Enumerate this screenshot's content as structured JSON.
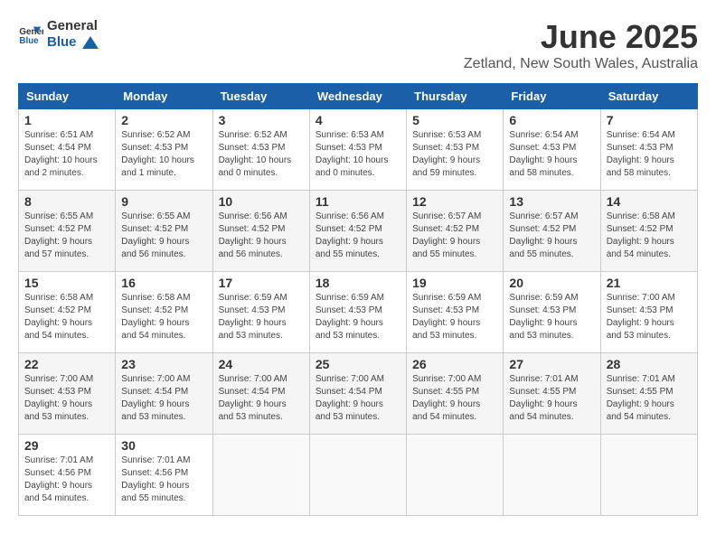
{
  "logo": {
    "line1": "General",
    "line2": "Blue"
  },
  "title": "June 2025",
  "subtitle": "Zetland, New South Wales, Australia",
  "headers": [
    "Sunday",
    "Monday",
    "Tuesday",
    "Wednesday",
    "Thursday",
    "Friday",
    "Saturday"
  ],
  "weeks": [
    [
      {
        "day": "1",
        "sunrise": "6:51 AM",
        "sunset": "4:54 PM",
        "daylight": "10 hours and 2 minutes."
      },
      {
        "day": "2",
        "sunrise": "6:52 AM",
        "sunset": "4:53 PM",
        "daylight": "10 hours and 1 minute."
      },
      {
        "day": "3",
        "sunrise": "6:52 AM",
        "sunset": "4:53 PM",
        "daylight": "10 hours and 0 minutes."
      },
      {
        "day": "4",
        "sunrise": "6:53 AM",
        "sunset": "4:53 PM",
        "daylight": "10 hours and 0 minutes."
      },
      {
        "day": "5",
        "sunrise": "6:53 AM",
        "sunset": "4:53 PM",
        "daylight": "9 hours and 59 minutes."
      },
      {
        "day": "6",
        "sunrise": "6:54 AM",
        "sunset": "4:53 PM",
        "daylight": "9 hours and 58 minutes."
      },
      {
        "day": "7",
        "sunrise": "6:54 AM",
        "sunset": "4:53 PM",
        "daylight": "9 hours and 58 minutes."
      }
    ],
    [
      {
        "day": "8",
        "sunrise": "6:55 AM",
        "sunset": "4:52 PM",
        "daylight": "9 hours and 57 minutes."
      },
      {
        "day": "9",
        "sunrise": "6:55 AM",
        "sunset": "4:52 PM",
        "daylight": "9 hours and 56 minutes."
      },
      {
        "day": "10",
        "sunrise": "6:56 AM",
        "sunset": "4:52 PM",
        "daylight": "9 hours and 56 minutes."
      },
      {
        "day": "11",
        "sunrise": "6:56 AM",
        "sunset": "4:52 PM",
        "daylight": "9 hours and 55 minutes."
      },
      {
        "day": "12",
        "sunrise": "6:57 AM",
        "sunset": "4:52 PM",
        "daylight": "9 hours and 55 minutes."
      },
      {
        "day": "13",
        "sunrise": "6:57 AM",
        "sunset": "4:52 PM",
        "daylight": "9 hours and 55 minutes."
      },
      {
        "day": "14",
        "sunrise": "6:58 AM",
        "sunset": "4:52 PM",
        "daylight": "9 hours and 54 minutes."
      }
    ],
    [
      {
        "day": "15",
        "sunrise": "6:58 AM",
        "sunset": "4:52 PM",
        "daylight": "9 hours and 54 minutes."
      },
      {
        "day": "16",
        "sunrise": "6:58 AM",
        "sunset": "4:52 PM",
        "daylight": "9 hours and 54 minutes."
      },
      {
        "day": "17",
        "sunrise": "6:59 AM",
        "sunset": "4:53 PM",
        "daylight": "9 hours and 53 minutes."
      },
      {
        "day": "18",
        "sunrise": "6:59 AM",
        "sunset": "4:53 PM",
        "daylight": "9 hours and 53 minutes."
      },
      {
        "day": "19",
        "sunrise": "6:59 AM",
        "sunset": "4:53 PM",
        "daylight": "9 hours and 53 minutes."
      },
      {
        "day": "20",
        "sunrise": "6:59 AM",
        "sunset": "4:53 PM",
        "daylight": "9 hours and 53 minutes."
      },
      {
        "day": "21",
        "sunrise": "7:00 AM",
        "sunset": "4:53 PM",
        "daylight": "9 hours and 53 minutes."
      }
    ],
    [
      {
        "day": "22",
        "sunrise": "7:00 AM",
        "sunset": "4:53 PM",
        "daylight": "9 hours and 53 minutes."
      },
      {
        "day": "23",
        "sunrise": "7:00 AM",
        "sunset": "4:54 PM",
        "daylight": "9 hours and 53 minutes."
      },
      {
        "day": "24",
        "sunrise": "7:00 AM",
        "sunset": "4:54 PM",
        "daylight": "9 hours and 53 minutes."
      },
      {
        "day": "25",
        "sunrise": "7:00 AM",
        "sunset": "4:54 PM",
        "daylight": "9 hours and 53 minutes."
      },
      {
        "day": "26",
        "sunrise": "7:00 AM",
        "sunset": "4:55 PM",
        "daylight": "9 hours and 54 minutes."
      },
      {
        "day": "27",
        "sunrise": "7:01 AM",
        "sunset": "4:55 PM",
        "daylight": "9 hours and 54 minutes."
      },
      {
        "day": "28",
        "sunrise": "7:01 AM",
        "sunset": "4:55 PM",
        "daylight": "9 hours and 54 minutes."
      }
    ],
    [
      {
        "day": "29",
        "sunrise": "7:01 AM",
        "sunset": "4:56 PM",
        "daylight": "9 hours and 54 minutes."
      },
      {
        "day": "30",
        "sunrise": "7:01 AM",
        "sunset": "4:56 PM",
        "daylight": "9 hours and 55 minutes."
      },
      null,
      null,
      null,
      null,
      null
    ]
  ],
  "labels": {
    "sunrise": "Sunrise:",
    "sunset": "Sunset:",
    "daylight": "Daylight:"
  }
}
